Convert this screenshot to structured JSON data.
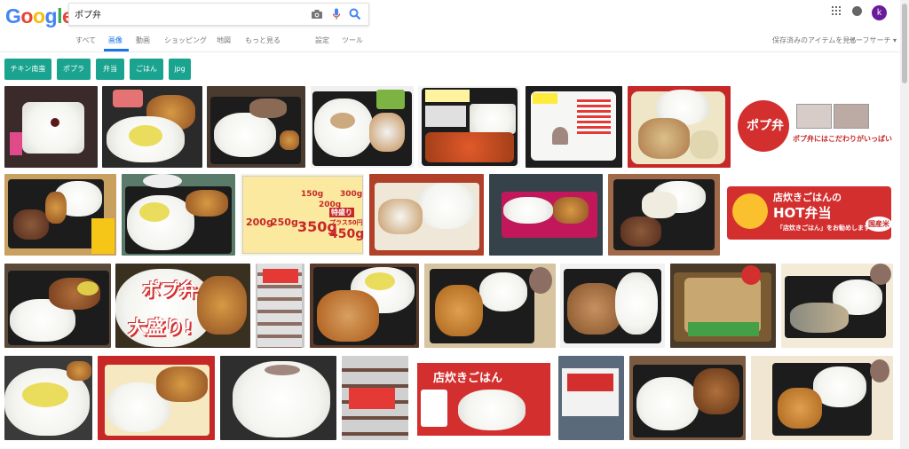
{
  "logo": {
    "letters": [
      "G",
      "o",
      "o",
      "g",
      "l",
      "e"
    ],
    "colors": [
      "#4285f4",
      "#ea4335",
      "#fbbc05",
      "#4285f4",
      "#34a853",
      "#ea4335"
    ]
  },
  "search": {
    "query": "ポプ弁"
  },
  "icons": {
    "camera": "camera-icon",
    "mic": "microphone-icon",
    "search": "search-icon",
    "apps": "apps-grid-icon",
    "notifications": "notifications-icon"
  },
  "user": {
    "initial": "k",
    "color": "#6a1b9a"
  },
  "tabs": [
    {
      "label": "すべて"
    },
    {
      "label": "画像",
      "active": true
    },
    {
      "label": "動画"
    },
    {
      "label": "ショッピング"
    },
    {
      "label": "地図"
    },
    {
      "label": "もっと見る"
    },
    {
      "label": "設定"
    },
    {
      "label": "ツール"
    }
  ],
  "right_links": {
    "saved": "保存済みのアイテムを見る",
    "safesearch": "セーフサーチ ▾"
  },
  "chips": [
    {
      "label": "チキン南蛮"
    },
    {
      "label": "ポプラ"
    },
    {
      "label": "弁当"
    },
    {
      "label": "ごはん"
    },
    {
      "label": "jpg"
    }
  ],
  "accent": "#1a73e8",
  "chip_color": "#1aa38f",
  "thumb_text": {
    "t14": "ポプ弁",
    "t14b": "ポプ弁にはこだわりがいっぱい!",
    "t18a": "150g",
    "t18b": "200g",
    "t18c": "300g",
    "t18d": "200g",
    "t18e": "250g",
    "t18f": "350g",
    "t18g": "450g",
    "t18h": "特盛り",
    "t18i": "プラス50円",
    "t22a": "店炊きごはんの",
    "t22b": "HOT弁当",
    "t22c": "「店炊きごはん」をお勧めします",
    "t22d": "国産米",
    "t24a": "ポプ弁",
    "t24b": "大盛り!",
    "t33": "店炊きごはん"
  }
}
